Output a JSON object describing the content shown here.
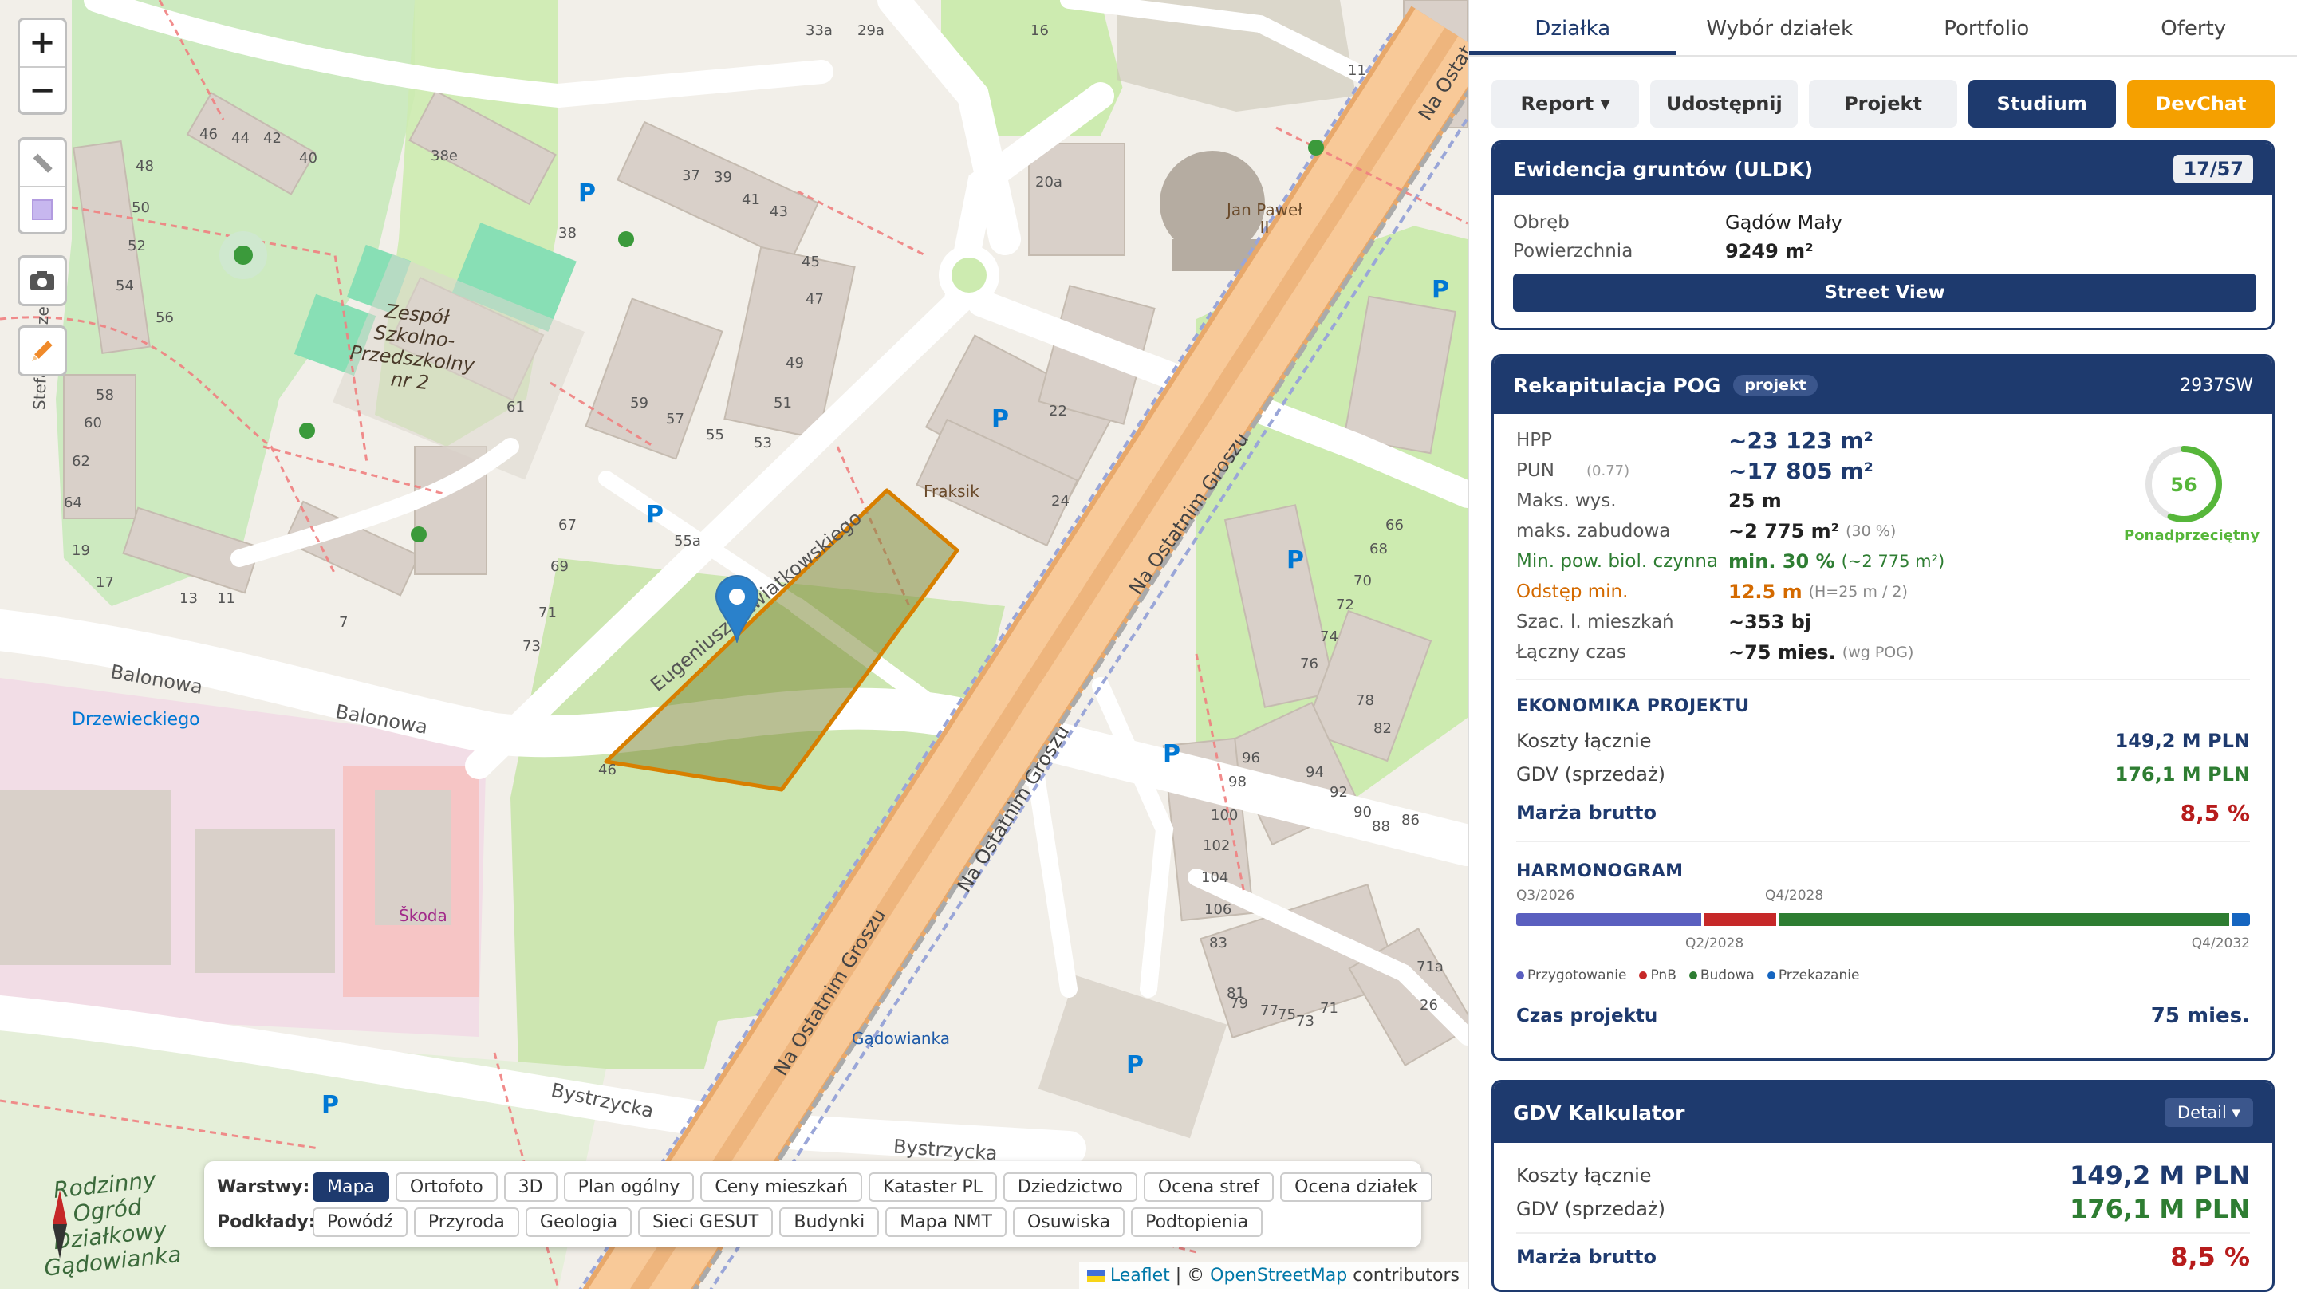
{
  "map": {
    "streets": {
      "balonowa": "Balonowa",
      "balonowa2": "Balonowa",
      "eugeniusza": "Eugeniusza Kwiatkowskiego",
      "na_ostatnim_groszu": "Na Ostatnim Groszu",
      "na_ostatnim_groszu2": "Na Ostatnim Groszu",
      "na_ostatnim_groszu3": "Na Ostatnim Groszu",
      "bystrzycka": "Bystrzycka",
      "bystrzycka2": "Bystrzycka",
      "na_ostat_top": "Na Ostat",
      "stefana": "Stefana Drzewie",
      "gadowianka_street": "Gądowianka"
    },
    "places": {
      "szkola": "Zespół\nSzkolno-\nPrzedszkolny\nnr 2",
      "drzewieckiego": "Drzewieckiego",
      "fraksik": "Fraksik",
      "jan_pawel": "Jan Paweł\nII",
      "skoda": "Škoda",
      "gadowianka": "Gądowianka",
      "ogrod": "Rodzinny\nOgród\nDziałkowy\nGądowianka"
    },
    "house_numbers": [
      "33a",
      "29a",
      "16",
      "11",
      "46",
      "44",
      "42",
      "40",
      "38e",
      "38",
      "48",
      "50",
      "52",
      "54",
      "56",
      "37",
      "39",
      "41",
      "43",
      "45",
      "47",
      "49",
      "51",
      "53",
      "55",
      "57",
      "59",
      "61",
      "58",
      "60",
      "62",
      "64",
      "19",
      "17",
      "13",
      "11",
      "55a",
      "67",
      "69",
      "71",
      "73",
      "7",
      "22",
      "24",
      "20a",
      "66",
      "68",
      "70",
      "72",
      "74",
      "76",
      "78",
      "82",
      "86",
      "94",
      "92",
      "90",
      "88",
      "96",
      "98",
      "100",
      "102",
      "104",
      "106",
      "83",
      "81",
      "79",
      "77",
      "75",
      "73",
      "71",
      "71a",
      "26",
      "46"
    ],
    "zoom_in": "+",
    "zoom_out": "−",
    "layers": {
      "warstwy_label": "Warstwy:",
      "warstwy": [
        "Mapa",
        "Ortofoto",
        "3D",
        "Plan ogólny",
        "Ceny mieszkań",
        "Kataster PL",
        "Dziedzictwo",
        "Ocena stref",
        "Ocena działek"
      ],
      "warstwy_active": "Mapa",
      "podklady_label": "Podkłady:",
      "podklady": [
        "Powódź",
        "Przyroda",
        "Geologia",
        "Sieci GESUT",
        "Budynki",
        "Mapa NMT",
        "Osuwiska",
        "Podtopienia"
      ]
    },
    "attribution": {
      "leaflet": "Leaflet",
      "sep": "| ©",
      "osm": "OpenStreetMap",
      "contributors": "contributors"
    }
  },
  "tabs": [
    "Działka",
    "Wybór działek",
    "Portfolio",
    "Oferty"
  ],
  "active_tab": "Działka",
  "buttons": {
    "report": "Report ▾",
    "share": "Udostępnij",
    "project": "Projekt",
    "study": "Studium",
    "devchat": "DevChat"
  },
  "uldk": {
    "title": "Ewidencja gruntów (ULDK)",
    "badge": "17/57",
    "obreb_label": "Obręb",
    "obreb_value": "Gądów Mały",
    "area_label": "Powierzchnia",
    "area_value": "9249 m²",
    "street_view": "Street View"
  },
  "pog": {
    "title": "Rekapitulacja POG",
    "tag": "projekt",
    "code": "2937SW",
    "rows": [
      {
        "k": "HPP",
        "v": "~23 123 m²",
        "note": ""
      },
      {
        "k": "PUN",
        "kn": "(0.77)",
        "v": "~17 805 m²",
        "note": ""
      },
      {
        "k": "Maks. wys.",
        "v": "25 m",
        "note": ""
      },
      {
        "k": "maks. zabudowa",
        "v": "~2 775 m²",
        "note": "(30 %)"
      },
      {
        "k": "Min. pow. biol. czynna",
        "v": "min. 30 %",
        "note": "(~2 775 m²)"
      },
      {
        "k": "Odstęp min.",
        "v": "12.5 m",
        "note": "(H=25 m / 2)"
      },
      {
        "k": "Szac. l. mieszkań",
        "v": "~353 bj",
        "note": ""
      },
      {
        "k": "Łączny czas",
        "v": "~75 mies.",
        "note": "(wg POG)"
      }
    ],
    "score": "56",
    "score_value": 56,
    "score_label": "Ponadprzeciętny",
    "econ_title": "EKONOMIKA PROJEKTU",
    "costs_label": "Koszty łącznie",
    "costs_value": "149,2 M PLN",
    "gdv_label": "GDV (sprzedaż)",
    "gdv_value": "176,1 M PLN",
    "margin_label": "Marża brutto",
    "margin_value": "8,5 %",
    "harm_title": "HARMONOGRAM",
    "timeline": {
      "top_labels": [
        "Q3/2026",
        "Q4/2028"
      ],
      "bottom_labels": [
        "Q2/2028",
        "Q4/2032"
      ],
      "segments": [
        {
          "name": "Przygotowanie",
          "share": 0.255,
          "color": "#5a5fbf"
        },
        {
          "name": "PnB",
          "share": 0.1,
          "color": "#c62828"
        },
        {
          "name": "Budowa",
          "share": 0.62,
          "color": "#2e7d32"
        },
        {
          "name": "Przekazanie",
          "share": 0.025,
          "color": "#1565c0"
        }
      ]
    },
    "legend": [
      "Przygotowanie",
      "PnB",
      "Budowa",
      "Przekazanie"
    ],
    "czas_label": "Czas projektu",
    "czas_value": "75 mies."
  },
  "gdv": {
    "title": "GDV Kalkulator",
    "detail": "Detail ▾",
    "costs_label": "Koszty łącznie",
    "costs_value": "149,2 M PLN",
    "gdv_label": "GDV (sprzedaż)",
    "gdv_value": "176,1 M PLN",
    "margin_label": "Marża brutto",
    "margin_value": "8,5 %"
  },
  "colors": {
    "navy": "#1e3a6e",
    "orange": "#f5a000",
    "green": "#2e7d32",
    "red": "#b71c1c",
    "odstep": "#d46a00"
  }
}
